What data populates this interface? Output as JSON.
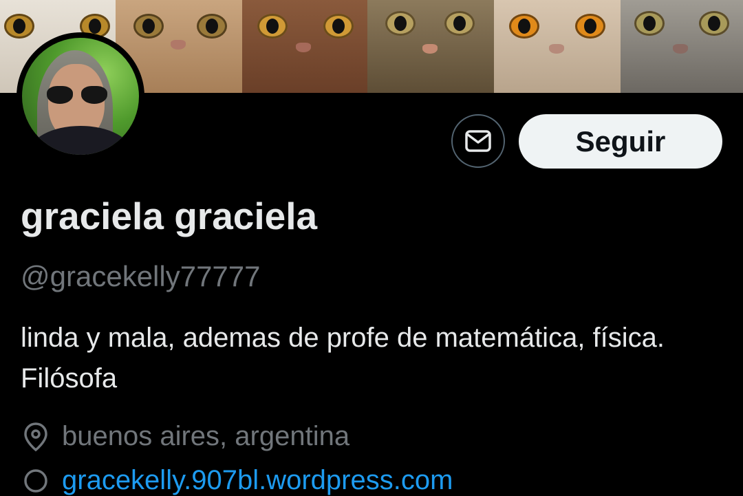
{
  "profile": {
    "display_name": "graciela graciela",
    "handle": "@gracekelly77777",
    "bio": "linda y mala, ademas de profe de matemática, física. Filósofa",
    "location": "buenos aires, argentina",
    "website": "gracekelly.907bl.wordpress.com"
  },
  "actions": {
    "follow_label": "Seguir",
    "message_icon": "envelope-icon"
  },
  "banner": {
    "description_icons": [
      "cat-face",
      "cat-face",
      "cat-face",
      "cat-face",
      "cat-face",
      "cat-face"
    ]
  },
  "colors": {
    "background": "#000000",
    "primary_text": "#e7e9ea",
    "secondary_text": "#71767b",
    "link": "#1d9bf0",
    "follow_button_bg": "#eff3f4",
    "follow_button_text": "#0f1419",
    "outline": "#536471"
  }
}
